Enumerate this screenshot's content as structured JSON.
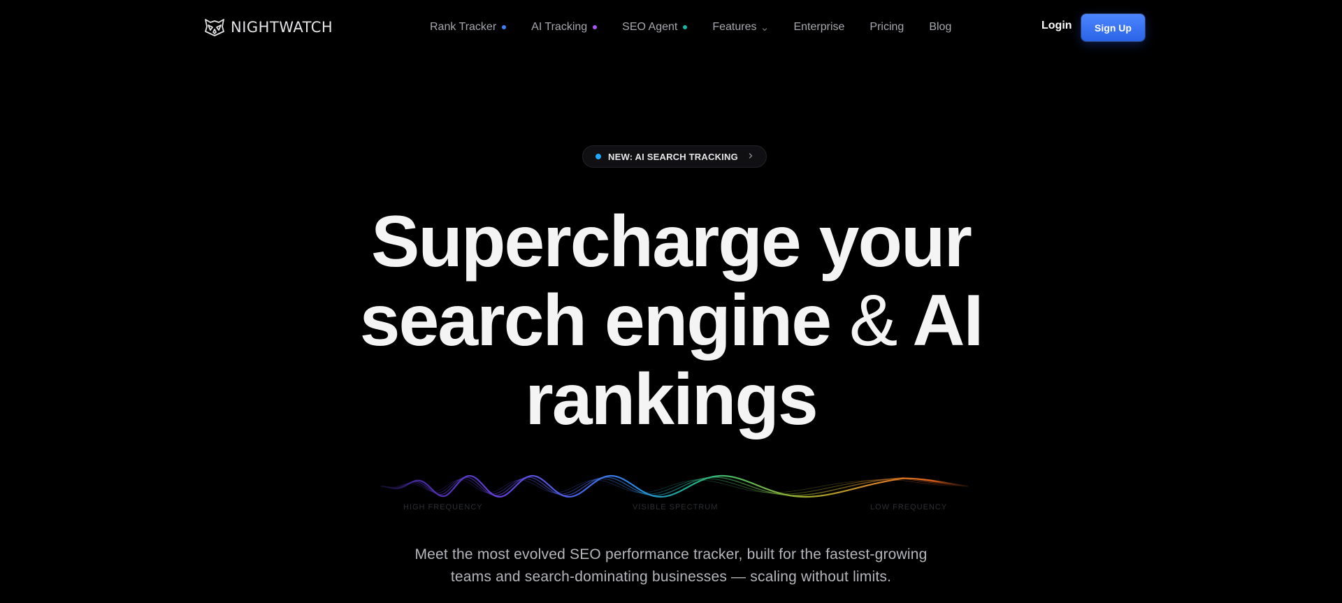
{
  "brand": {
    "name": "NIGHTWATCH"
  },
  "nav": {
    "items": [
      {
        "label": "Rank Tracker",
        "dot_color": "#3b82f6"
      },
      {
        "label": "AI Tracking",
        "dot_color": "#a855f7"
      },
      {
        "label": "SEO Agent",
        "dot_color": "#14b8a6"
      },
      {
        "label": "Features",
        "has_dropdown": true
      },
      {
        "label": "Enterprise"
      },
      {
        "label": "Pricing"
      },
      {
        "label": "Blog"
      }
    ],
    "login_label": "Login",
    "signup_label": "Sign Up"
  },
  "badge": {
    "label": "NEW: AI SEARCH TRACKING",
    "dot_color": "#1ea7fd"
  },
  "hero": {
    "line1": "Supercharge your",
    "line2_start": "search engine ",
    "line2_amp": "&",
    "line2_end": " AI",
    "line3": "rankings"
  },
  "spectrum": {
    "labels": {
      "high": "HIGH FREQUENCY",
      "visible": "VISIBLE SPECTRUM",
      "low": "LOW FREQUENCY"
    },
    "colors": [
      "#3b2a8f",
      "#6d3fe0",
      "#5b5cf0",
      "#3f7ef5",
      "#22b59a",
      "#4cc26e",
      "#a8b830",
      "#e0902a",
      "#e86a1f"
    ]
  },
  "subtext": {
    "line1": "Meet the most evolved SEO performance tracker, built for the fastest-growing",
    "line2": "teams and search-dominating businesses — scaling without limits."
  },
  "colors": {
    "background": "#000000",
    "accent": "#3b74f4"
  }
}
